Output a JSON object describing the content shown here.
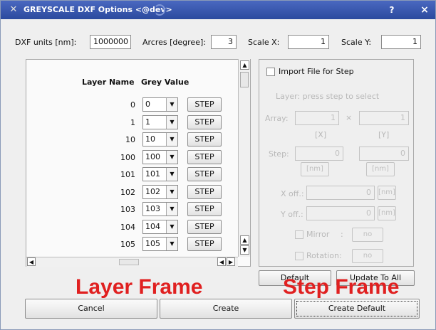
{
  "window": {
    "title": "GREYSCALE DXF Options <@dev>",
    "help_glyph": "?",
    "close_glyph": "×",
    "app_icon": "wrench-icon"
  },
  "top_fields": {
    "dxf_units_label": "DXF units [nm]:",
    "dxf_units_value": "1000000",
    "arcres_label": "Arcres [degree]:",
    "arcres_value": "3",
    "scale_x_label": "Scale X:",
    "scale_x_value": "1",
    "scale_y_label": "Scale Y:",
    "scale_y_value": "1"
  },
  "layer_frame": {
    "header_layer_name": "Layer Name",
    "header_grey_value": "Grey Value",
    "rows": [
      {
        "name": "0",
        "grey": "0",
        "button": "STEP"
      },
      {
        "name": "1",
        "grey": "1",
        "button": "STEP"
      },
      {
        "name": "10",
        "grey": "10",
        "button": "STEP"
      },
      {
        "name": "100",
        "grey": "100",
        "button": "STEP"
      },
      {
        "name": "101",
        "grey": "101",
        "button": "STEP"
      },
      {
        "name": "102",
        "grey": "102",
        "button": "STEP"
      },
      {
        "name": "103",
        "grey": "103",
        "button": "STEP"
      },
      {
        "name": "104",
        "grey": "104",
        "button": "STEP"
      },
      {
        "name": "105",
        "grey": "105",
        "button": "STEP"
      }
    ],
    "annotation": "Layer Frame"
  },
  "step_frame": {
    "import_label": "Import File for Step",
    "layer_hint": "Layer: press step to select",
    "array_label": "Array:",
    "array_x": "1",
    "array_y": "1",
    "times": "×",
    "x_unit": "[X]",
    "y_unit": "[Y]",
    "step_label": "Step:",
    "step_x": "0",
    "step_y": "0",
    "nm_label": "[nm]",
    "xoff_label": "X off.:",
    "xoff_value": "0",
    "yoff_label": "Y off.:",
    "yoff_value": "0",
    "mirror_label": "Mirror",
    "mirror_colon": ":",
    "mirror_value": "no",
    "rotation_label": "Rotation:",
    "rotation_value": "no",
    "default_button": "Default",
    "update_button": "Update To All",
    "annotation": "Step Frame"
  },
  "bottom": {
    "cancel": "Cancel",
    "create": "Create",
    "create_default": "Create Default"
  },
  "colors": {
    "titlebar": "#2b4a9e",
    "annotation": "#e02020"
  }
}
